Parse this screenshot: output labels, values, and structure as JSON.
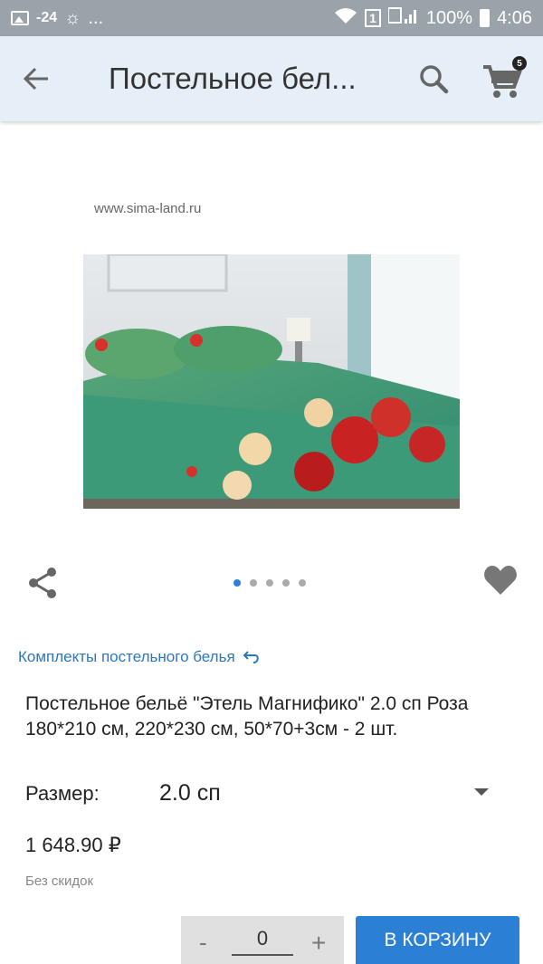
{
  "status_bar": {
    "temperature": "-24",
    "more": "...",
    "sim": "1",
    "battery": "100%",
    "time": "4:06"
  },
  "header": {
    "title": "Постельное бел...",
    "cart_count": "5"
  },
  "gallery": {
    "watermark": "www.sima-land.ru",
    "dot_count": 5,
    "active_index": 0
  },
  "product": {
    "category": "Комплекты постельного белья",
    "title": "Постельное бельё \"Этель Магнифико\" 2.0 сп Роза 180*210 см, 220*230 см, 50*70+3см - 2 шт.",
    "size_label": "Размер:",
    "size_value": "2.0 сп",
    "price": "1 648.90 ₽",
    "discount_note": "Без скидок"
  },
  "purchase": {
    "minus": "-",
    "quantity": "0",
    "plus": "+",
    "add_to_cart": "В КОРЗИНУ"
  },
  "colors": {
    "accent": "#2b80d6",
    "app_bar": "#e6eff7",
    "status_bar": "#9aa3a9"
  }
}
